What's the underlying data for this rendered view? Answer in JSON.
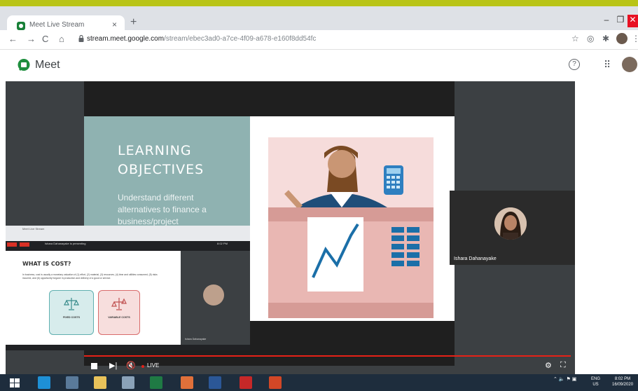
{
  "browser": {
    "tab_title": "Meet Live Stream",
    "tab_close": "×",
    "new_tab": "+",
    "url_host": "stream.meet.google.com",
    "url_path": "/stream/ebec3ad0-a7ce-4f09-a678-e160f8dd54fc"
  },
  "meet": {
    "app_name": "Meet",
    "help_label": "?",
    "accent_color": "#b9c417"
  },
  "slide": {
    "heading_line1": "LEARNING",
    "heading_line2": "OBJECTIVES",
    "body": "Understand different alternatives to finance a business/project"
  },
  "participants": {
    "main_name": "Ishara Dahanayake"
  },
  "inset": {
    "presenting_text": "Ishara Dahanayake is presenting",
    "clock": "8:02 PM",
    "cost_title": "WHAT IS COST?",
    "cost_text": "In business, cost is usually a monetary valuation of (1) effort, (2) material, (3) resources, (4) time and utilities consumed, (5) risks incurred, and (6) opportunity forgone in production and delivery of a good or service.",
    "fixed_label": "FIXED COSTS",
    "variable_label": "VARIABLE COSTS"
  },
  "player": {
    "live_label": "LIVE"
  },
  "taskbar": {
    "lang_line1": "ENG",
    "lang_line2": "US",
    "time": "8:02 PM",
    "date": "16/09/2020"
  }
}
